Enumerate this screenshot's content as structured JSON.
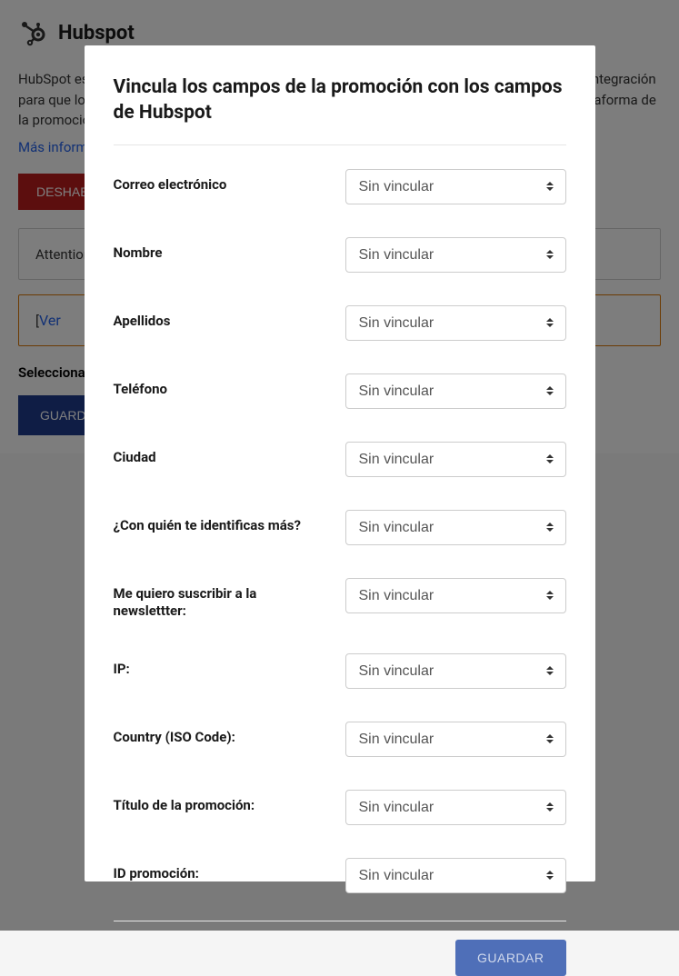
{
  "background": {
    "title": "Hubspot",
    "description": "HubSpot es una plataforma CRM (gestión de relación con el cliente) de marketing. Utiliza esta integración para que los usuarios que participen en esta promoción se agreguen automáticamente a la plataforma de la promoción.",
    "more_info": "Más información",
    "disable_btn": "DESHABILITAR",
    "box1_text": "Attention",
    "box2_prefix": "[",
    "box2_link": "Ver",
    "select_label": "Selecciona la integración asociada a todos los usuarios",
    "save_btn": "GUARDAR"
  },
  "modal": {
    "title": "Vincula los campos de la promoción con los campos de Hubspot",
    "default_option": "Sin vincular",
    "save_btn": "GUARDAR",
    "fields": [
      {
        "label": "Correo electrónico",
        "value": "Sin vincular"
      },
      {
        "label": "Nombre",
        "value": "Sin vincular"
      },
      {
        "label": "Apellidos",
        "value": "Sin vincular"
      },
      {
        "label": "Teléfono",
        "value": "Sin vincular"
      },
      {
        "label": "Ciudad",
        "value": "Sin vincular"
      },
      {
        "label": "¿Con quién te identificas más?",
        "value": "Sin vincular"
      },
      {
        "label": "Me quiero suscribir a la newslettter:",
        "value": "Sin vincular"
      },
      {
        "label": "IP:",
        "value": "Sin vincular"
      },
      {
        "label": "Country (ISO Code):",
        "value": "Sin vincular"
      },
      {
        "label": "Título de la promoción:",
        "value": "Sin vincular"
      },
      {
        "label": "ID promoción:",
        "value": "Sin vincular"
      }
    ]
  }
}
